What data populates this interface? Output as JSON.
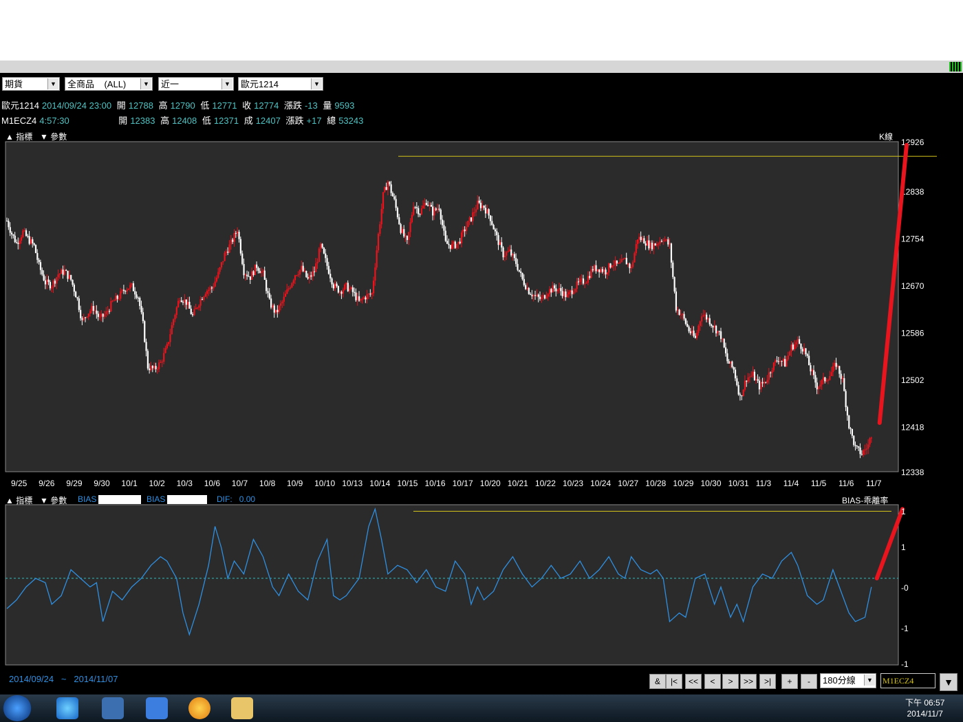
{
  "toolbar": {
    "market": "期貨",
    "product": "全商品",
    "product_scope": "(ALL)",
    "period_sel": "近一",
    "contract": "歐元1214"
  },
  "quote1": {
    "name": "歐元1214",
    "datetime": "2014/09/24 23:00",
    "open_lbl": "開",
    "open": "12788",
    "high_lbl": "高",
    "high": "12790",
    "low_lbl": "低",
    "low": "12771",
    "close_lbl": "收",
    "close": "12774",
    "chg_lbl": "漲跌",
    "chg": "-13",
    "vol_lbl": "量",
    "vol": "9593"
  },
  "quote2": {
    "name": "M1ECZ4",
    "time": "4:57:30",
    "open_lbl": "開",
    "open": "12383",
    "high_lbl": "高",
    "high": "12408",
    "low_lbl": "低",
    "low": "12371",
    "close_lbl": "成",
    "close": "12407",
    "chg_lbl": "漲跌",
    "chg": "+17",
    "vol_lbl": "總",
    "vol": "53243"
  },
  "kpanel": {
    "ind_label": "指標",
    "param_label": "參數",
    "title": "K線"
  },
  "bpanel": {
    "ind_label": "指標",
    "param_label": "參數",
    "bias1": "BIAS",
    "bias2": "BIAS",
    "dif_label": "DIF:",
    "dif_value": "0.00",
    "title": "BIAS-乖離率"
  },
  "footer": {
    "start": "2014/09/24",
    "sep": "~",
    "end": "2014/11/07",
    "buttons": [
      "&",
      "|<",
      "<<",
      "<",
      ">",
      ">>",
      ">|",
      "+",
      "-"
    ],
    "interval": "180分線",
    "symbol": "M1ECZ4"
  },
  "taskbar": {
    "time": "下午 06:57",
    "date": "2014/11/7"
  },
  "colors": {
    "up": "#e8141e",
    "down": "#ffffff",
    "panel": "#2b2b2b",
    "hline": "#d4c31a",
    "bias_line": "#2f8fe0",
    "zero_line": "#2fbfbf",
    "annotation": "#e8141e"
  },
  "chart_data": [
    {
      "type": "candlestick",
      "title": "K線",
      "y_ticks": [
        12926,
        12838,
        12754,
        12670,
        12586,
        12502,
        12418,
        12338
      ],
      "ylim": [
        12338,
        12926
      ],
      "x_tick_labels": [
        "9/25",
        "9/26",
        "9/29",
        "9/30",
        "10/1",
        "10/2",
        "10/3",
        "10/6",
        "10/7",
        "10/8",
        "10/9",
        "10/10",
        "10/13",
        "10/14",
        "10/15",
        "10/16",
        "10/17",
        "10/20",
        "10/21",
        "10/22",
        "10/23",
        "10/24",
        "10/27",
        "10/28",
        "10/29",
        "10/30",
        "10/31",
        "11/3",
        "11/4",
        "11/5",
        "11/6",
        "11/7"
      ],
      "close_path": [
        [
          0,
          12785
        ],
        [
          3,
          12762
        ],
        [
          6,
          12745
        ],
        [
          10,
          12765
        ],
        [
          14,
          12750
        ],
        [
          17,
          12740
        ],
        [
          20,
          12705
        ],
        [
          24,
          12675
        ],
        [
          28,
          12670
        ],
        [
          32,
          12690
        ],
        [
          36,
          12695
        ],
        [
          40,
          12680
        ],
        [
          44,
          12645
        ],
        [
          47,
          12605
        ],
        [
          50,
          12620
        ],
        [
          54,
          12630
        ],
        [
          58,
          12610
        ],
        [
          62,
          12620
        ],
        [
          66,
          12640
        ],
        [
          70,
          12650
        ],
        [
          74,
          12665
        ],
        [
          78,
          12668
        ],
        [
          82,
          12650
        ],
        [
          85,
          12600
        ],
        [
          88,
          12525
        ],
        [
          92,
          12520
        ],
        [
          96,
          12532
        ],
        [
          100,
          12560
        ],
        [
          104,
          12610
        ],
        [
          108,
          12650
        ],
        [
          112,
          12640
        ],
        [
          116,
          12615
        ],
        [
          120,
          12640
        ],
        [
          124,
          12660
        ],
        [
          128,
          12665
        ],
        [
          132,
          12690
        ],
        [
          136,
          12725
        ],
        [
          140,
          12745
        ],
        [
          144,
          12770
        ],
        [
          148,
          12695
        ],
        [
          152,
          12685
        ],
        [
          156,
          12705
        ],
        [
          160,
          12690
        ],
        [
          164,
          12640
        ],
        [
          168,
          12620
        ],
        [
          172,
          12640
        ],
        [
          176,
          12665
        ],
        [
          180,
          12690
        ],
        [
          184,
          12700
        ],
        [
          188,
          12680
        ],
        [
          192,
          12695
        ],
        [
          196,
          12740
        ],
        [
          200,
          12705
        ],
        [
          204,
          12670
        ],
        [
          208,
          12660
        ],
        [
          212,
          12668
        ],
        [
          216,
          12658
        ],
        [
          220,
          12640
        ],
        [
          224,
          12650
        ],
        [
          228,
          12655
        ],
        [
          232,
          12760
        ],
        [
          235,
          12830
        ],
        [
          238,
          12855
        ],
        [
          242,
          12820
        ],
        [
          246,
          12770
        ],
        [
          250,
          12745
        ],
        [
          254,
          12815
        ],
        [
          258,
          12800
        ],
        [
          262,
          12820
        ],
        [
          266,
          12800
        ],
        [
          270,
          12810
        ],
        [
          274,
          12745
        ],
        [
          278,
          12740
        ],
        [
          282,
          12745
        ],
        [
          286,
          12770
        ],
        [
          290,
          12790
        ],
        [
          294,
          12815
        ],
        [
          298,
          12810
        ],
        [
          302,
          12790
        ],
        [
          306,
          12755
        ],
        [
          310,
          12725
        ],
        [
          314,
          12730
        ],
        [
          318,
          12710
        ],
        [
          322,
          12680
        ],
        [
          326,
          12660
        ],
        [
          330,
          12650
        ],
        [
          334,
          12645
        ],
        [
          338,
          12660
        ],
        [
          342,
          12665
        ],
        [
          346,
          12660
        ],
        [
          350,
          12650
        ],
        [
          354,
          12665
        ],
        [
          358,
          12675
        ],
        [
          362,
          12680
        ],
        [
          366,
          12700
        ],
        [
          370,
          12700
        ],
        [
          374,
          12695
        ],
        [
          378,
          12710
        ],
        [
          382,
          12705
        ],
        [
          386,
          12715
        ],
        [
          390,
          12700
        ],
        [
          394,
          12755
        ],
        [
          398,
          12750
        ],
        [
          402,
          12740
        ],
        [
          406,
          12745
        ],
        [
          410,
          12755
        ],
        [
          414,
          12740
        ],
        [
          418,
          12630
        ],
        [
          422,
          12615
        ],
        [
          426,
          12590
        ],
        [
          430,
          12575
        ],
        [
          434,
          12620
        ],
        [
          438,
          12610
        ],
        [
          442,
          12595
        ],
        [
          446,
          12580
        ],
        [
          450,
          12535
        ],
        [
          454,
          12520
        ],
        [
          458,
          12470
        ],
        [
          462,
          12505
        ],
        [
          466,
          12510
        ],
        [
          470,
          12490
        ],
        [
          474,
          12500
        ],
        [
          478,
          12525
        ],
        [
          482,
          12540
        ],
        [
          486,
          12530
        ],
        [
          490,
          12560
        ],
        [
          494,
          12570
        ],
        [
          498,
          12555
        ],
        [
          502,
          12520
        ],
        [
          506,
          12490
        ],
        [
          510,
          12500
        ],
        [
          514,
          12510
        ],
        [
          518,
          12530
        ],
        [
          522,
          12500
        ],
        [
          526,
          12420
        ],
        [
          530,
          12380
        ],
        [
          534,
          12370
        ],
        [
          538,
          12385
        ],
        [
          540,
          12405
        ]
      ],
      "resistance_line": 12900,
      "annotation": {
        "type": "arrow_line",
        "from": [
          540,
          12425
        ],
        "to": [
          556,
          12920
        ]
      }
    },
    {
      "type": "line",
      "title": "BIAS-乖離率",
      "y_ticks": [
        "1",
        "1",
        "-0",
        "-1",
        "-1"
      ],
      "ylim": [
        -2,
        1.7
      ],
      "zero_line": 0,
      "bias_path": [
        [
          0,
          -0.7
        ],
        [
          6,
          -0.5
        ],
        [
          12,
          -0.2
        ],
        [
          18,
          0.0
        ],
        [
          24,
          -0.1
        ],
        [
          28,
          -0.6
        ],
        [
          34,
          -0.4
        ],
        [
          40,
          0.2
        ],
        [
          46,
          0.0
        ],
        [
          52,
          -0.2
        ],
        [
          56,
          -0.1
        ],
        [
          60,
          -1.0
        ],
        [
          66,
          -0.3
        ],
        [
          72,
          -0.5
        ],
        [
          78,
          -0.2
        ],
        [
          84,
          0.0
        ],
        [
          90,
          0.3
        ],
        [
          96,
          0.5
        ],
        [
          100,
          0.4
        ],
        [
          106,
          0.0
        ],
        [
          110,
          -0.8
        ],
        [
          114,
          -1.3
        ],
        [
          120,
          -0.6
        ],
        [
          126,
          0.3
        ],
        [
          130,
          1.2
        ],
        [
          134,
          0.7
        ],
        [
          138,
          0.0
        ],
        [
          142,
          0.4
        ],
        [
          148,
          0.1
        ],
        [
          154,
          0.9
        ],
        [
          160,
          0.5
        ],
        [
          166,
          -0.2
        ],
        [
          170,
          -0.4
        ],
        [
          176,
          0.1
        ],
        [
          182,
          -0.3
        ],
        [
          188,
          -0.5
        ],
        [
          194,
          0.4
        ],
        [
          200,
          0.9
        ],
        [
          204,
          -0.4
        ],
        [
          208,
          -0.5
        ],
        [
          212,
          -0.4
        ],
        [
          216,
          -0.2
        ],
        [
          220,
          0.0
        ],
        [
          226,
          1.2
        ],
        [
          230,
          1.6
        ],
        [
          234,
          0.9
        ],
        [
          238,
          0.1
        ],
        [
          244,
          0.3
        ],
        [
          250,
          0.2
        ],
        [
          256,
          -0.1
        ],
        [
          262,
          0.2
        ],
        [
          268,
          -0.2
        ],
        [
          274,
          -0.3
        ],
        [
          280,
          0.4
        ],
        [
          286,
          0.1
        ],
        [
          290,
          -0.6
        ],
        [
          294,
          -0.2
        ],
        [
          298,
          -0.5
        ],
        [
          304,
          -0.3
        ],
        [
          310,
          0.2
        ],
        [
          316,
          0.5
        ],
        [
          322,
          0.1
        ],
        [
          328,
          -0.2
        ],
        [
          334,
          0.0
        ],
        [
          340,
          0.3
        ],
        [
          346,
          0.0
        ],
        [
          352,
          0.1
        ],
        [
          358,
          0.4
        ],
        [
          364,
          0.0
        ],
        [
          370,
          0.2
        ],
        [
          376,
          0.5
        ],
        [
          382,
          0.1
        ],
        [
          386,
          0.0
        ],
        [
          390,
          0.5
        ],
        [
          396,
          0.2
        ],
        [
          402,
          0.1
        ],
        [
          406,
          0.2
        ],
        [
          410,
          0.0
        ],
        [
          414,
          -1.0
        ],
        [
          420,
          -0.8
        ],
        [
          424,
          -0.9
        ],
        [
          430,
          0.0
        ],
        [
          436,
          0.1
        ],
        [
          442,
          -0.6
        ],
        [
          446,
          -0.2
        ],
        [
          452,
          -0.9
        ],
        [
          456,
          -0.6
        ],
        [
          460,
          -1.0
        ],
        [
          466,
          -0.2
        ],
        [
          472,
          0.1
        ],
        [
          478,
          0.0
        ],
        [
          484,
          0.4
        ],
        [
          490,
          0.6
        ],
        [
          494,
          0.3
        ],
        [
          500,
          -0.4
        ],
        [
          506,
          -0.6
        ],
        [
          510,
          -0.5
        ],
        [
          516,
          0.2
        ],
        [
          520,
          -0.2
        ],
        [
          526,
          -0.8
        ],
        [
          530,
          -1.0
        ],
        [
          536,
          -0.9
        ],
        [
          540,
          -0.2
        ]
      ],
      "resistance_line": 1.55,
      "annotation": {
        "type": "arrow_line",
        "from": [
          540,
          0.0
        ],
        "to": [
          556,
          1.6
        ]
      }
    }
  ]
}
